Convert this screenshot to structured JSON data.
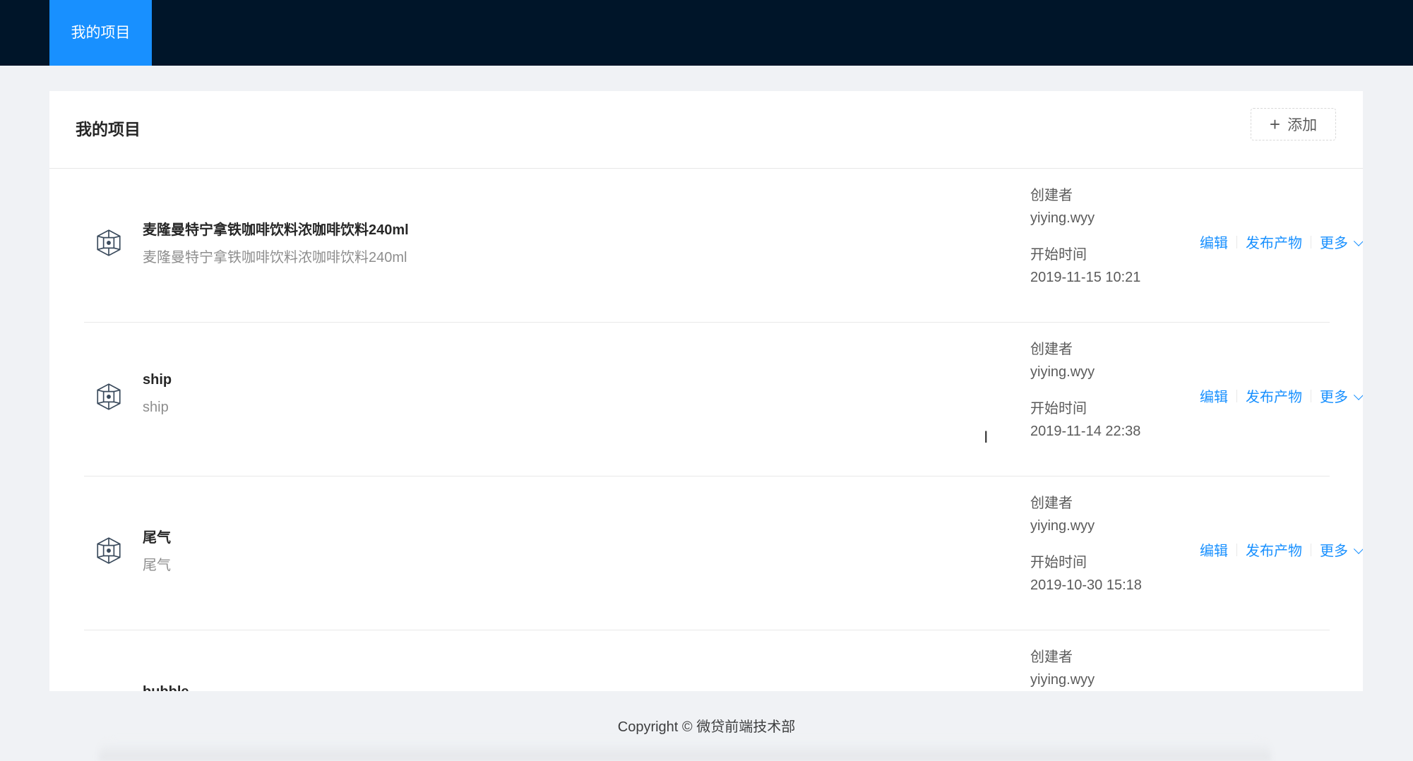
{
  "nav": {
    "tab_label": "我的项目"
  },
  "card": {
    "title": "我的项目",
    "add_label": "添加"
  },
  "labels": {
    "creator": "创建者",
    "start_time": "开始时间"
  },
  "actions": {
    "edit": "编辑",
    "publish": "发布产物",
    "more": "更多"
  },
  "projects": [
    {
      "title": "麦隆曼特宁拿铁咖啡饮料浓咖啡饮料240ml",
      "desc": "麦隆曼特宁拿铁咖啡饮料浓咖啡饮料240ml",
      "creator": "yiying.wyy",
      "start": "2019-11-15 10:21"
    },
    {
      "title": "ship",
      "desc": "ship",
      "creator": "yiying.wyy",
      "start": "2019-11-14 22:38"
    },
    {
      "title": "尾气",
      "desc": "尾气",
      "creator": "yiying.wyy",
      "start": "2019-10-30 15:18"
    },
    {
      "title": "bubble",
      "creator": "yiying.wyy"
    }
  ],
  "footer": {
    "copyright": "Copyright © 微贷前端技术部"
  },
  "colors": {
    "header_bg": "#001529",
    "accent": "#1890ff",
    "page_bg": "#f0f2f5"
  },
  "icons": {
    "project": "cube-icon",
    "add": "plus-icon",
    "more": "chevron-down-icon"
  }
}
